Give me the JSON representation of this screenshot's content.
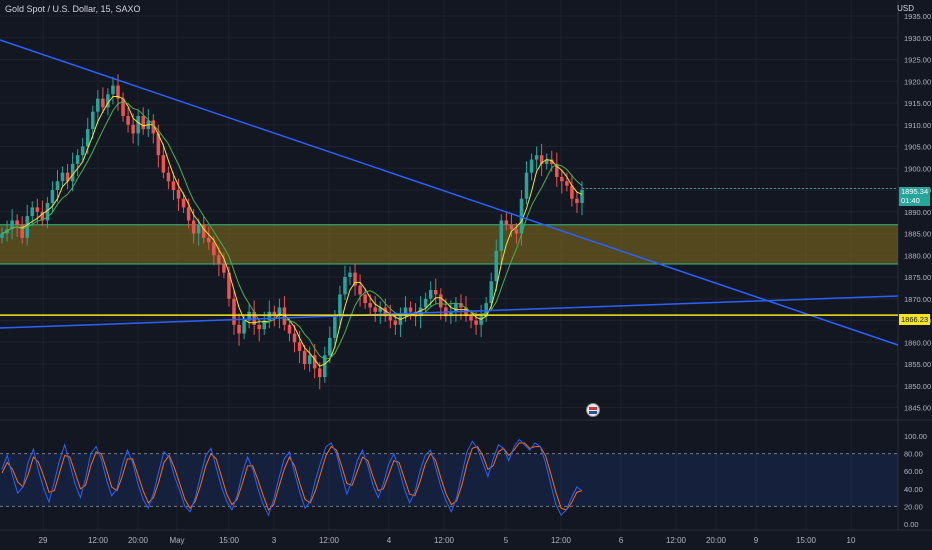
{
  "header": {
    "symbol_title": "Gold Spot / U.S. Dollar, 15, SAXO",
    "currency": "USD"
  },
  "price_scale": {
    "labels": [
      "1935.00",
      "1930.00",
      "1925.00",
      "1920.00",
      "1915.00",
      "1910.00",
      "1905.00",
      "1900.00",
      "1895.00",
      "1890.00",
      "1885.00",
      "1880.00",
      "1875.00",
      "1870.00",
      "1865.00",
      "1860.00",
      "1855.00",
      "1850.00",
      "1845.00"
    ],
    "last_price": "1895.34",
    "countdown": "01:40",
    "line_label": "1866.23"
  },
  "rsi_scale": {
    "labels": [
      "100.00",
      "80.00",
      "60.00",
      "40.00",
      "20.00",
      "0.00"
    ]
  },
  "time_axis": {
    "labels": [
      "29",
      "12:00",
      "20:00",
      "May",
      "15:00",
      "3",
      "12:00",
      "4",
      "12:00",
      "5",
      "12:00",
      "6",
      "12:00",
      "20:00",
      "9",
      "15:00",
      "10"
    ]
  },
  "colors": {
    "background": "#131722",
    "up_candle": "#26a69a",
    "down_candle": "#ef5350",
    "trendline": "#2962ff",
    "support_line": "#f5e625",
    "zone_fill": "#6b5a1f",
    "zone_border": "#2ebd85",
    "ma_fast": "#f5e625",
    "ma_slow": "#4caf50",
    "stoch_k": "#2962ff",
    "stoch_d": "#ff6d00"
  },
  "chart_data": {
    "type": "candlestick",
    "timeframe": "15",
    "ylim": [
      1845,
      1935
    ],
    "zone": [
      1878,
      1887
    ],
    "horizontal_line": 1866.23,
    "last_price": 1895.34,
    "closes": [
      1885,
      1886,
      1888,
      1887,
      1884,
      1889,
      1891,
      1890,
      1888,
      1892,
      1895,
      1897,
      1899,
      1897,
      1901,
      1903,
      1905,
      1909,
      1913,
      1916,
      1914,
      1917,
      1919,
      1916,
      1912,
      1910,
      1908,
      1912,
      1909,
      1911,
      1908,
      1903,
      1899,
      1897,
      1895,
      1893,
      1891,
      1888,
      1885,
      1887,
      1884,
      1883,
      1880,
      1878,
      1876,
      1870,
      1864,
      1862,
      1865,
      1867,
      1864,
      1863,
      1865,
      1867,
      1866,
      1868,
      1864,
      1862,
      1860,
      1858,
      1855,
      1857,
      1854,
      1852,
      1857,
      1861,
      1866,
      1871,
      1875,
      1876,
      1873,
      1871,
      1869,
      1868,
      1867,
      1868,
      1866,
      1865,
      1864,
      1866,
      1868,
      1867,
      1866,
      1868,
      1870,
      1872,
      1871,
      1868,
      1866,
      1867,
      1869,
      1868,
      1866,
      1865,
      1864,
      1866,
      1869,
      1874,
      1881,
      1888,
      1887,
      1886,
      1885,
      1893,
      1899,
      1902,
      1903,
      1901,
      1902,
      1901,
      1898,
      1897,
      1896,
      1893,
      1892,
      1895
    ]
  },
  "rsi_data": {
    "ylim": [
      0,
      100
    ],
    "bands": [
      20,
      80
    ],
    "k": [
      62,
      78,
      55,
      35,
      42,
      70,
      85,
      60,
      40,
      25,
      48,
      72,
      90,
      68,
      45,
      30,
      52,
      80,
      88,
      74,
      50,
      32,
      40,
      66,
      84,
      70,
      46,
      28,
      18,
      35,
      60,
      82,
      76,
      54,
      38,
      20,
      14,
      30,
      55,
      78,
      86,
      64,
      42,
      26,
      16,
      32,
      58,
      76,
      62,
      40,
      22,
      10,
      28,
      52,
      74,
      82,
      58,
      36,
      18,
      26,
      50,
      70,
      88,
      92,
      80,
      56,
      34,
      50,
      72,
      84,
      66,
      44,
      30,
      46,
      68,
      80,
      62,
      40,
      24,
      36,
      60,
      78,
      84,
      64,
      42,
      26,
      14,
      30,
      56,
      82,
      94,
      86,
      70,
      54,
      74,
      90,
      86,
      72,
      88,
      96,
      90,
      84,
      92,
      88,
      70,
      46,
      22,
      10,
      16,
      30,
      42,
      38
    ],
    "d": [
      58,
      70,
      62,
      48,
      42,
      56,
      76,
      70,
      54,
      36,
      38,
      58,
      78,
      76,
      58,
      40,
      44,
      66,
      82,
      80,
      62,
      42,
      38,
      54,
      74,
      74,
      56,
      38,
      24,
      30,
      48,
      70,
      78,
      64,
      46,
      28,
      18,
      26,
      44,
      66,
      80,
      74,
      54,
      34,
      22,
      28,
      46,
      66,
      66,
      50,
      32,
      16,
      22,
      42,
      62,
      76,
      66,
      46,
      28,
      24,
      38,
      58,
      78,
      88,
      84,
      66,
      46,
      44,
      60,
      76,
      72,
      54,
      38,
      40,
      56,
      72,
      70,
      52,
      34,
      32,
      48,
      68,
      80,
      72,
      52,
      34,
      22,
      26,
      44,
      68,
      86,
      88,
      78,
      62,
      66,
      82,
      86,
      78,
      84,
      92,
      92,
      86,
      88,
      88,
      78,
      58,
      36,
      18,
      16,
      24,
      36,
      38
    ]
  }
}
